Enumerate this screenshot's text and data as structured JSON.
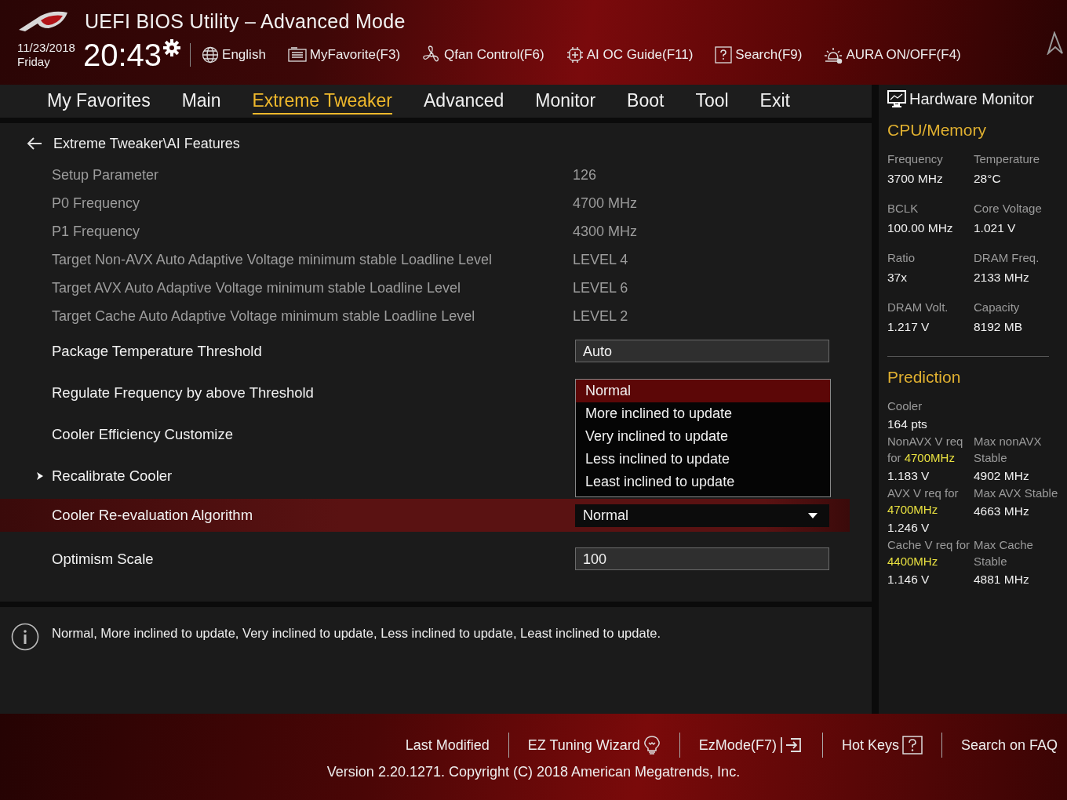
{
  "window": {
    "title": "UEFI BIOS Utility – Advanced Mode"
  },
  "clock": {
    "date": "11/23/2018",
    "day": "Friday",
    "time": "20:43"
  },
  "toolbar": [
    {
      "label": "English"
    },
    {
      "label": "MyFavorite(F3)"
    },
    {
      "label": "Qfan Control(F6)"
    },
    {
      "label": "AI OC Guide(F11)"
    },
    {
      "label": "Search(F9)"
    },
    {
      "label": "AURA ON/OFF(F4)"
    }
  ],
  "tabs": [
    {
      "label": "My Favorites",
      "selected": false
    },
    {
      "label": "Main",
      "selected": false
    },
    {
      "label": "Extreme Tweaker",
      "selected": true
    },
    {
      "label": "Advanced",
      "selected": false
    },
    {
      "label": "Monitor",
      "selected": false
    },
    {
      "label": "Boot",
      "selected": false
    },
    {
      "label": "Tool",
      "selected": false
    },
    {
      "label": "Exit",
      "selected": false
    }
  ],
  "breadcrumb": "Extreme Tweaker\\AI Features",
  "settings": [
    {
      "kind": "info",
      "label": "Setup Parameter",
      "value": "126",
      "selected": false
    },
    {
      "kind": "info",
      "label": "P0 Frequency",
      "value": "4700 MHz",
      "selected": false
    },
    {
      "kind": "info",
      "label": "P1 Frequency",
      "value": "4300 MHz",
      "selected": false
    },
    {
      "kind": "info",
      "label": "Target Non-AVX Auto Adaptive Voltage minimum stable Loadline Level",
      "value": "LEVEL 4",
      "selected": false
    },
    {
      "kind": "info",
      "label": "Target AVX Auto Adaptive Voltage minimum stable Loadline Level",
      "value": "LEVEL 6",
      "selected": false
    },
    {
      "kind": "info",
      "label": "Target Cache Auto Adaptive Voltage minimum stable Loadline Level",
      "value": "LEVEL 2",
      "selected": false
    },
    {
      "kind": "field",
      "label": "Package Temperature Threshold",
      "value": "Auto",
      "selected": false
    },
    {
      "kind": "label",
      "label": "Regulate Frequency by above Threshold",
      "selected": false
    },
    {
      "kind": "label",
      "label": "Cooler Efficiency Customize",
      "selected": false
    },
    {
      "kind": "submenu",
      "label": "Recalibrate Cooler",
      "selected": false
    },
    {
      "kind": "dropdown",
      "label": "Cooler Re-evaluation Algorithm",
      "value": "Normal",
      "selected": true
    },
    {
      "kind": "field",
      "label": "Optimism Scale",
      "value": "100",
      "selected": false
    }
  ],
  "dropdown_menu": {
    "options": [
      {
        "label": "Normal",
        "selected": true
      },
      {
        "label": "More inclined to update",
        "selected": false
      },
      {
        "label": "Very inclined to update",
        "selected": false
      },
      {
        "label": "Less inclined to update",
        "selected": false
      },
      {
        "label": "Least inclined to update",
        "selected": false
      }
    ]
  },
  "help_text": "Normal, More inclined to update, Very inclined to update, Less inclined to update, Least inclined to update.",
  "hardware_monitor": {
    "title": "Hardware Monitor",
    "sections": [
      {
        "title": "CPU/Memory",
        "rows": [
          [
            {
              "label": "Frequency",
              "value": "3700 MHz"
            },
            {
              "label": "Temperature",
              "value": "28°C"
            }
          ],
          [
            {
              "label": "BCLK",
              "value": "100.00 MHz"
            },
            {
              "label": "Core Voltage",
              "value": "1.021 V"
            }
          ],
          [
            {
              "label": "Ratio",
              "value": "37x"
            },
            {
              "label": "DRAM Freq.",
              "value": "2133 MHz"
            }
          ],
          [
            {
              "label": "DRAM Volt.",
              "value": "1.217 V"
            },
            {
              "label": "Capacity",
              "value": "8192 MB"
            }
          ]
        ]
      },
      {
        "title": "Prediction",
        "rows": [
          [
            {
              "label": "Cooler",
              "value": "164 pts"
            }
          ],
          [
            {
              "label": "NonAVX V req for **4700MHz**",
              "value": "1.183 V"
            },
            {
              "label": "Max nonAVX Stable",
              "value": "4902 MHz"
            }
          ],
          [
            {
              "label": "AVX V req for **4700MHz**",
              "value": "1.246 V"
            },
            {
              "label": "Max AVX Stable",
              "value": "4663 MHz"
            }
          ],
          [
            {
              "label": "Cache V req for **4400MHz**",
              "value": "1.146 V"
            },
            {
              "label": "Max Cache Stable",
              "value": "4881 MHz"
            }
          ]
        ]
      }
    ]
  },
  "footer_links": [
    {
      "label": "Last Modified"
    },
    {
      "label": "EZ Tuning Wizard"
    },
    {
      "label": "EzMode(F7)"
    },
    {
      "label": "Hot Keys"
    },
    {
      "label": "Search on FAQ"
    }
  ],
  "version": "Version 2.20.1271. Copyright (C) 2018 American Megatrends, Inc."
}
